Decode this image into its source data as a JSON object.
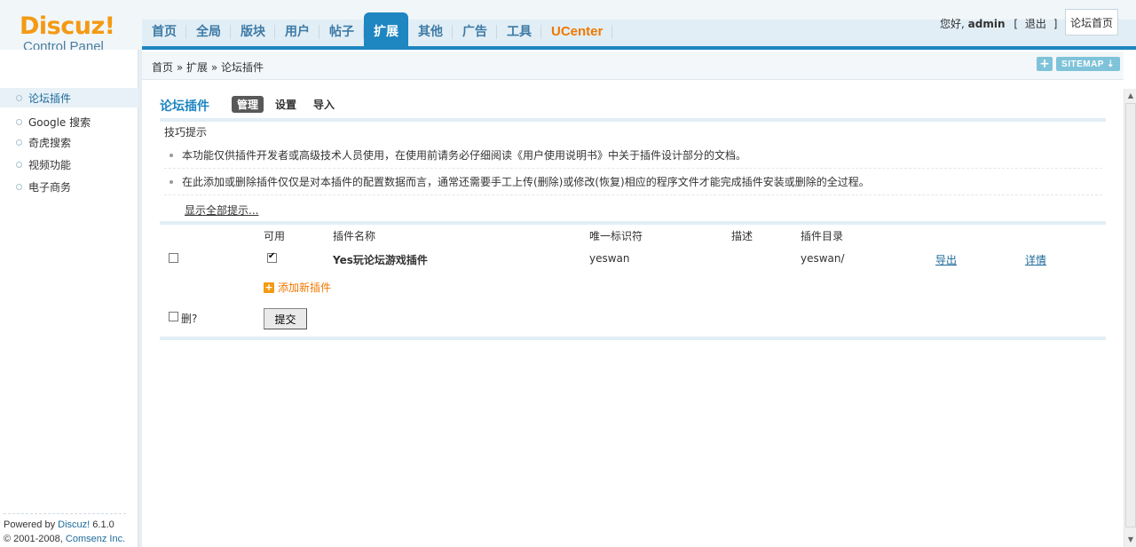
{
  "logo": {
    "main": "Discuz!",
    "sub": "Control Panel"
  },
  "nav": [
    {
      "label": "首页",
      "key": "home"
    },
    {
      "label": "全局",
      "key": "global"
    },
    {
      "label": "版块",
      "key": "forums"
    },
    {
      "label": "用户",
      "key": "users"
    },
    {
      "label": "帖子",
      "key": "posts"
    },
    {
      "label": "扩展",
      "key": "extensions",
      "active": true
    },
    {
      "label": "其他",
      "key": "other"
    },
    {
      "label": "广告",
      "key": "ads"
    },
    {
      "label": "工具",
      "key": "tools"
    },
    {
      "label": "UCenter",
      "key": "ucenter"
    }
  ],
  "user": {
    "greeting": "您好,",
    "name": "admin",
    "logout_open": "[",
    "logout": "退出",
    "logout_close": "]"
  },
  "forum_home": "论坛首页",
  "breadcrumb": {
    "home": "首页",
    "sep": "»",
    "ext": "扩展",
    "current": "论坛插件"
  },
  "sitemap": {
    "plus": "+",
    "label": "SITEMAP ⇣"
  },
  "sidebar": {
    "items": [
      {
        "label": "论坛插件",
        "active": true
      },
      {
        "label": "Google 搜索"
      },
      {
        "label": "奇虎搜索"
      },
      {
        "label": "视频功能"
      },
      {
        "label": "电子商务"
      }
    ],
    "footer": {
      "powered_prefix": "Powered by",
      "powered_link": "Discuz!",
      "version": "6.1.0",
      "copyright_prefix": "© 2001-2008,",
      "copyright_link": "Comsenz Inc."
    }
  },
  "main": {
    "title": "论坛插件",
    "tabs": [
      {
        "label": "管理",
        "active": true
      },
      {
        "label": "设置"
      },
      {
        "label": "导入"
      }
    ],
    "tips": {
      "title": "技巧提示",
      "items": [
        "本功能仅供插件开发者或高级技术人员使用，在使用前请务必仔细阅读《用户使用说明书》中关于插件设计部分的文档。",
        "在此添加或删除插件仅仅是对本插件的配置数据而言，通常还需要手工上传(删除)或修改(恢复)相应的程序文件才能完成插件安装或删除的全过程。"
      ],
      "show_all": "显示全部提示..."
    },
    "table": {
      "headers": {
        "enabled": "可用",
        "name": "插件名称",
        "identifier": "唯一标识符",
        "description": "描述",
        "directory": "插件目录"
      },
      "rows": [
        {
          "name": "Yes玩论坛游戏插件",
          "identifier": "yeswan",
          "description": "",
          "directory": "yeswan/",
          "export": "导出",
          "details": "详情",
          "enabled": true,
          "selected": false
        }
      ],
      "add_plugin": "添加新插件",
      "delete_label": "删?",
      "submit": "提交"
    }
  }
}
